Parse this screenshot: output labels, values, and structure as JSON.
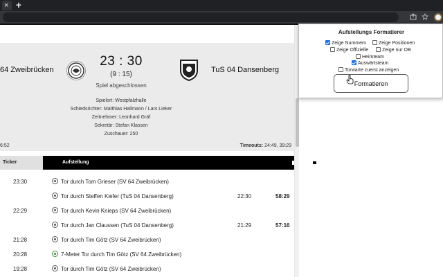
{
  "browser": {
    "tab_close": "×",
    "new_tab": "+",
    "icons": [
      "share-icon",
      "star-icon",
      "extension-icon"
    ]
  },
  "match": {
    "home_team": "64 Zweibrücken",
    "away_team": "TuS 04 Dansenberg",
    "score": "23 : 30",
    "halftime": "(9 : 15)",
    "status": "Spiel abgeschlossen",
    "info": [
      "Spielort: Westpfalzhalle",
      "Schiedsrichter: Matthias Hallmann / Lars Lieker",
      "Zeitnehmer: Leonhard Gräf",
      "Sekretär: Stefan Klassen",
      "Zuschauer: 250"
    ],
    "time_left": "6:52",
    "timeouts_label": "Timeouts:",
    "timeouts_value": " 24:49, 39:29"
  },
  "tabs": {
    "ticker": "Ticker",
    "lineup": "Aufstellung",
    "progress": 0.85
  },
  "ticker": [
    {
      "time": "23:30",
      "text": "Tor durch Tom Grieser (SV 64 Zweibrücken)",
      "at": "",
      "score": "",
      "icon": "handball-icon"
    },
    {
      "time": "",
      "text": "Tor durch Steffen Kiefer (TuS 04 Dansenberg)",
      "at": "22:30",
      "score": "58:29",
      "icon": "handball-icon"
    },
    {
      "time": "22:29",
      "text": "Tor durch Kevin Knieps (SV 64 Zweibrücken)",
      "at": "",
      "score": "",
      "icon": "handball-icon"
    },
    {
      "time": "",
      "text": "Tor durch Jan Claussen (TuS 04 Dansenberg)",
      "at": "21:29",
      "score": "57:16",
      "icon": "handball-icon"
    },
    {
      "time": "21:28",
      "text": "Tor durch Tim Götz (SV 64 Zweibrücken)",
      "at": "",
      "score": "",
      "icon": "handball-icon"
    },
    {
      "time": "20:28",
      "text": "7-Meter Tor durch Tim Götz (SV 64 Zweibrücken)",
      "at": "",
      "score": "",
      "icon": "penalty-icon"
    },
    {
      "time": "19:28",
      "text": "Tor durch Tim Götz (SV 64 Zweibrücken)",
      "at": "",
      "score": "",
      "icon": "handball-icon"
    }
  ],
  "popup": {
    "title": "Aufstellungs Formatierer",
    "options": [
      {
        "label": "Zeige Nummern",
        "checked": true
      },
      {
        "label": "Zeige Positionen",
        "checked": false
      },
      {
        "label": "Zeige Offizielle",
        "checked": false
      },
      {
        "label": "Zeige nur OB",
        "checked": false
      },
      {
        "label": "Heimteam",
        "checked": false
      },
      {
        "label": "Auswärtsteam",
        "checked": true
      },
      {
        "label": "Torwarte zuerst anzeigen",
        "checked": false
      }
    ],
    "button": "Formatieren"
  },
  "colors": {
    "header_bg": "#ebebeb",
    "tab_active": "#000000",
    "checkbox_checked": "#1a73e8",
    "penalty_icon": "#3a8a3a"
  }
}
